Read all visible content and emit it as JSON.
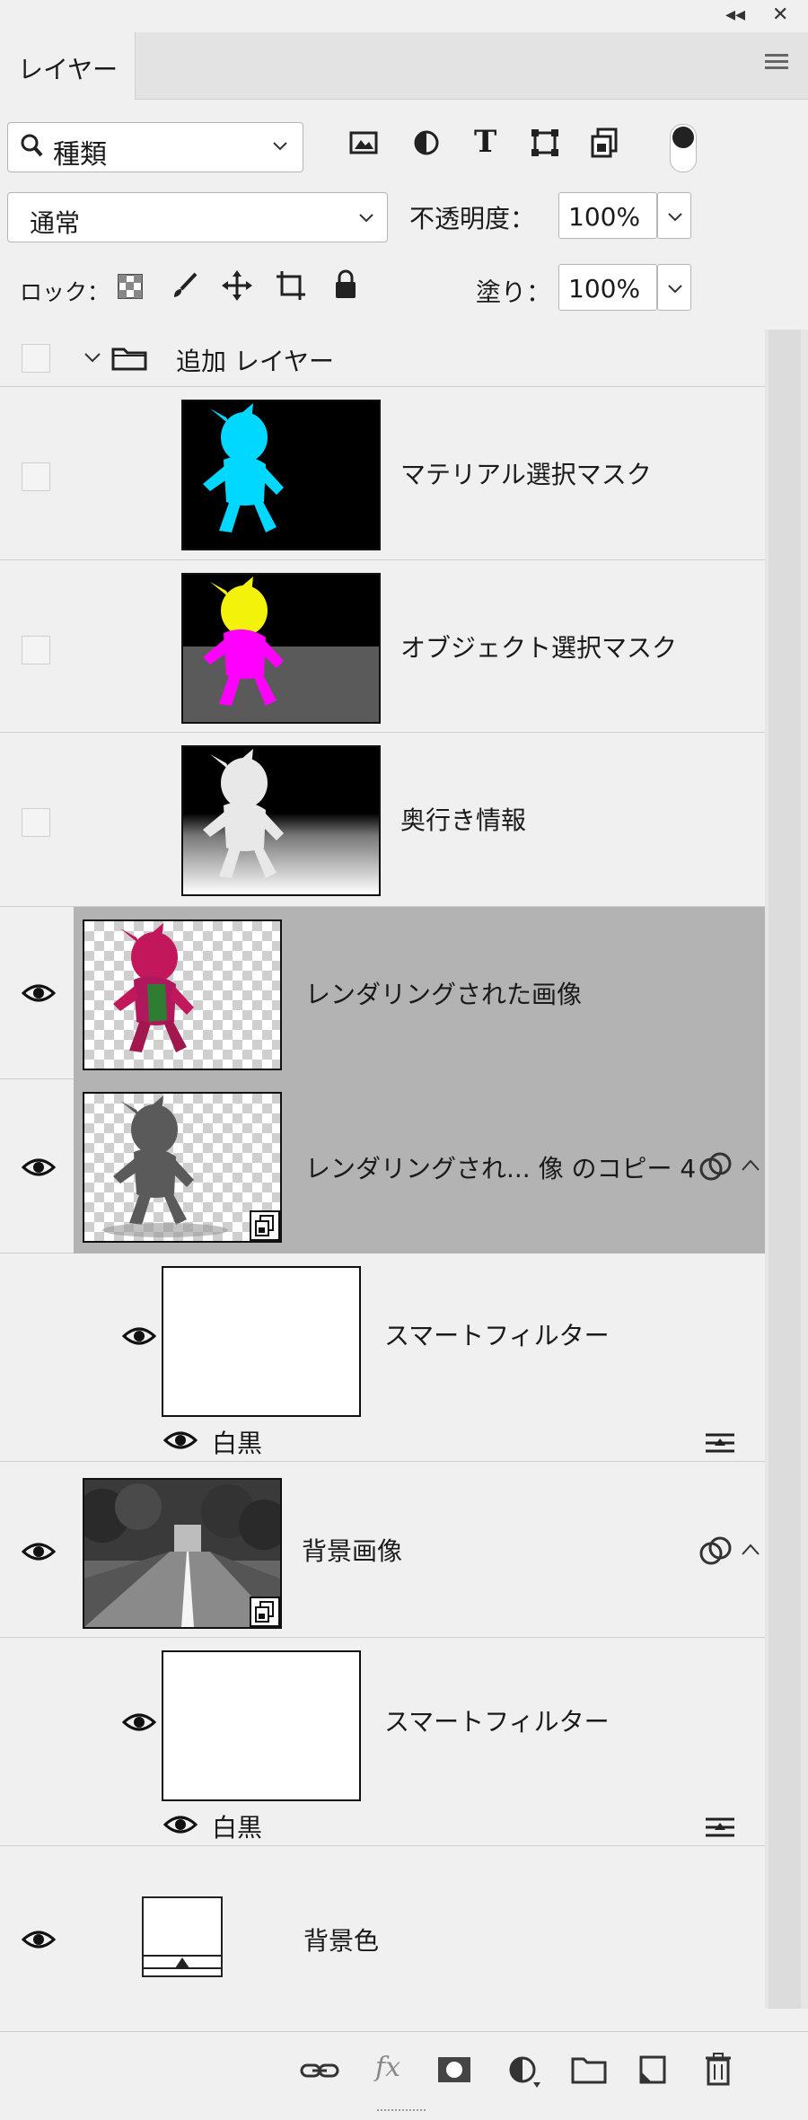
{
  "window": {
    "collapse_glyph": "◂◂",
    "close_glyph": "✕"
  },
  "tab": {
    "label": "レイヤー"
  },
  "filter": {
    "search_icon": "🔍",
    "value": "種類",
    "chevron": "⌵"
  },
  "filter_icons": [
    "image-filter-icon",
    "adjustment-filter-icon",
    "text-filter-icon",
    "shape-filter-icon",
    "smart-object-filter-icon"
  ],
  "blend": {
    "mode": "通常",
    "opacity_label": "不透明度：",
    "opacity": "100%",
    "fill_label": "塗り：",
    "fill": "100%"
  },
  "lock": {
    "label": "ロック："
  },
  "group": {
    "name": "追加 レイヤー"
  },
  "layers": [
    {
      "name": "マテリアル選択マスク",
      "visible": false
    },
    {
      "name": "オブジェクト選択マスク",
      "visible": false
    },
    {
      "name": "奥行き情報",
      "visible": false
    },
    {
      "name": "レンダリングされた画像",
      "visible": true,
      "selected": true
    },
    {
      "name": "レンダリングされ... 像 のコピー 4",
      "visible": true,
      "selected": true
    },
    {
      "name": "スマートフィルター",
      "visible": true
    },
    {
      "name": "白黒",
      "visible": true
    },
    {
      "name": "背景画像",
      "visible": true
    },
    {
      "name": "スマートフィルター",
      "visible": true
    },
    {
      "name": "白黒",
      "visible": true
    },
    {
      "name": "背景色",
      "visible": true
    }
  ],
  "footer_icons": [
    "link-layers-icon",
    "fx-icon",
    "layer-mask-icon",
    "adjustment-layer-icon",
    "new-group-icon",
    "new-layer-icon",
    "delete-icon"
  ],
  "colors": {
    "panel": "#f0f0f0",
    "selected": "#b3b3b3",
    "cyan": "#00d8ff",
    "magenta": "#ff00ff",
    "yellow": "#f2f20a"
  }
}
